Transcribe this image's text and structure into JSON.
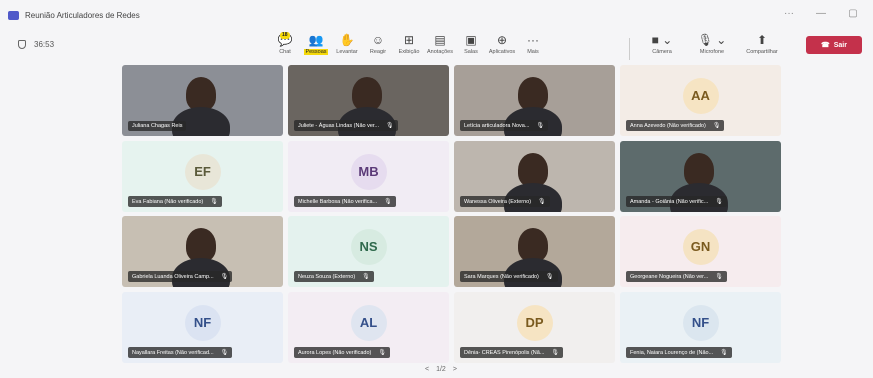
{
  "window": {
    "title": "Reunião Articuladores de Redes",
    "controls": [
      "···",
      "—",
      "▢"
    ]
  },
  "toolbar": {
    "timer": "36:53",
    "items": [
      {
        "name": "chat",
        "label": "Chat",
        "icon": "speech-bubble-icon",
        "glyph": "💬"
      },
      {
        "name": "people",
        "label": "Pessoas",
        "icon": "people-icon",
        "glyph": "👥",
        "badge": "18",
        "active": true
      },
      {
        "name": "raise",
        "label": "Levantar",
        "icon": "hand-icon",
        "glyph": "✋"
      },
      {
        "name": "react",
        "label": "Reagir",
        "icon": "smiley-icon",
        "glyph": "☺"
      },
      {
        "name": "view",
        "label": "Exibição",
        "icon": "grid-icon",
        "glyph": "⊞"
      },
      {
        "name": "notes",
        "label": "Anotações",
        "icon": "notes-icon",
        "glyph": "▤"
      },
      {
        "name": "rooms",
        "label": "Salas",
        "icon": "rooms-icon",
        "glyph": "▣"
      },
      {
        "name": "apps",
        "label": "Aplicativos",
        "icon": "plus-icon",
        "glyph": "⊕"
      },
      {
        "name": "more",
        "label": "Mais",
        "icon": "more-icon",
        "glyph": "···"
      }
    ],
    "media": [
      {
        "name": "camera",
        "label": "Câmera",
        "icon": "camera-icon",
        "glyph": "■ ⌄"
      },
      {
        "name": "mic",
        "label": "Microfone",
        "icon": "mic-muted-icon",
        "glyph": "🎙 ⌄"
      },
      {
        "name": "share",
        "label": "Compartilhar",
        "icon": "share-icon",
        "glyph": "⬆"
      }
    ],
    "leave_label": "Sair",
    "leave_color": "#c4314b"
  },
  "tiles": [
    {
      "row": 0,
      "col": 0,
      "type": "video",
      "name": "Juliana Chagas Reis",
      "muted": false,
      "bg": "#8c8f96"
    },
    {
      "row": 0,
      "col": 1,
      "type": "video",
      "name": "Juliete - Águas Lindas (Não ver...",
      "muted": true,
      "bg": "#6a6560"
    },
    {
      "row": 0,
      "col": 2,
      "type": "video",
      "name": "Letícia articuladora Nova...",
      "muted": true,
      "bg": "#a79f98"
    },
    {
      "row": 0,
      "col": 3,
      "type": "avatar",
      "initials": "AA",
      "name": "Anna Azevedo (Não verificado)",
      "muted": true,
      "bg": "#f3ece6",
      "avatar_bg": "#f6e4c3",
      "avatar_fg": "#7a5a1e"
    },
    {
      "row": 1,
      "col": 0,
      "type": "avatar",
      "initials": "EF",
      "name": "Eva Fabiana (Não verificado)",
      "muted": true,
      "bg": "#e6f3ef",
      "avatar_bg": "#e8e6d8",
      "avatar_fg": "#5a5a3a"
    },
    {
      "row": 1,
      "col": 1,
      "type": "avatar",
      "initials": "MB",
      "name": "Michelle Barbosa (Não verifica...",
      "muted": true,
      "bg": "#f1ecf4",
      "avatar_bg": "#e6dcef",
      "avatar_fg": "#5b3a78"
    },
    {
      "row": 1,
      "col": 2,
      "type": "video",
      "name": "Wanessa Oliveira (Externo)",
      "muted": true,
      "bg": "#bdb6ae"
    },
    {
      "row": 1,
      "col": 3,
      "type": "video",
      "name": "Amanda - Goiânia (Não verific...",
      "muted": true,
      "bg": "#5d6b6c"
    },
    {
      "row": 2,
      "col": 0,
      "type": "video",
      "name": "Gabriela Luanda Oliveira Camp...",
      "muted": true,
      "bg": "#c7bfb3"
    },
    {
      "row": 2,
      "col": 1,
      "type": "avatar",
      "initials": "NS",
      "name": "Neuza Souza (Externo)",
      "muted": true,
      "bg": "#e4f2ee",
      "avatar_bg": "#d7ebe1",
      "avatar_fg": "#2f6a4c"
    },
    {
      "row": 2,
      "col": 2,
      "type": "video",
      "name": "Sara Marques (Não verificado)",
      "muted": true,
      "bg": "#b3a89a"
    },
    {
      "row": 2,
      "col": 3,
      "type": "avatar",
      "initials": "GN",
      "name": "Georgeane Nogueira (Não ver...",
      "muted": true,
      "bg": "#f6ecee",
      "avatar_bg": "#f5e3c3",
      "avatar_fg": "#7a5a1e"
    },
    {
      "row": 3,
      "col": 0,
      "type": "avatar",
      "initials": "NF",
      "name": "Nayallara Freitas (Não verificad...",
      "muted": true,
      "bg": "#e9eef6",
      "avatar_bg": "#dbe3f2",
      "avatar_fg": "#34508a"
    },
    {
      "row": 3,
      "col": 1,
      "type": "avatar",
      "initials": "AL",
      "name": "Aurora Lopes (Não verificado)",
      "muted": true,
      "bg": "#f3edf3",
      "avatar_bg": "#dfe5f0",
      "avatar_fg": "#34508a"
    },
    {
      "row": 3,
      "col": 2,
      "type": "avatar",
      "initials": "DP",
      "name": "Dênia- CREAS Pirenópolis (Nã...",
      "muted": true,
      "bg": "#f1efee",
      "avatar_bg": "#f6e4c3",
      "avatar_fg": "#7a5a1e"
    },
    {
      "row": 3,
      "col": 3,
      "type": "avatar",
      "initials": "NF",
      "name": "Fenia, Naiara Lourenço de (Não...",
      "muted": true,
      "bg": "#eaf1f5",
      "avatar_bg": "#dbe6ef",
      "avatar_fg": "#34508a"
    }
  ],
  "pager": {
    "prev": "<",
    "text": "1/2",
    "next": ">"
  }
}
